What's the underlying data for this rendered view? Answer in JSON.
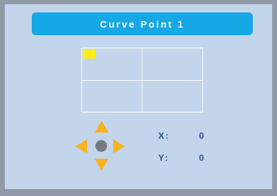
{
  "title": "Curve Point 1",
  "coordinates": {
    "x_label": "X:",
    "x_value": "0",
    "y_label": "Y:",
    "y_value": "0"
  },
  "colors": {
    "background_frame": "#8f9aa6",
    "panel": "#c3d5ea",
    "title_bar": "#15a7e6",
    "cursor_marker": "#ffed1a",
    "arrows": "#f7b21d",
    "center_dot": "#737a83",
    "coordinate_text": "#2f5485"
  },
  "icons": {
    "up": "arrow-up-icon",
    "down": "arrow-down-icon",
    "left": "arrow-left-icon",
    "right": "arrow-right-icon",
    "center": "center-dot-icon"
  }
}
